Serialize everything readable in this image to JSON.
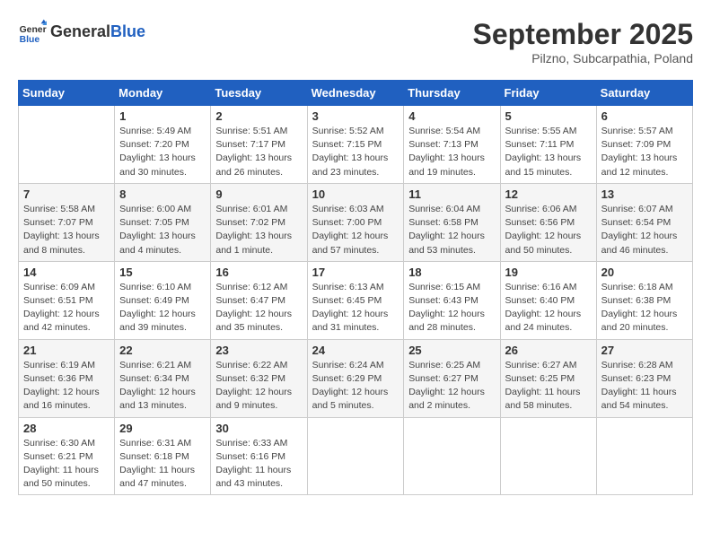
{
  "logo": {
    "text_general": "General",
    "text_blue": "Blue"
  },
  "title": "September 2025",
  "subtitle": "Pilzno, Subcarpathia, Poland",
  "days_of_week": [
    "Sunday",
    "Monday",
    "Tuesday",
    "Wednesday",
    "Thursday",
    "Friday",
    "Saturday"
  ],
  "weeks": [
    [
      {
        "day": "",
        "info": ""
      },
      {
        "day": "1",
        "info": "Sunrise: 5:49 AM\nSunset: 7:20 PM\nDaylight: 13 hours\nand 30 minutes."
      },
      {
        "day": "2",
        "info": "Sunrise: 5:51 AM\nSunset: 7:17 PM\nDaylight: 13 hours\nand 26 minutes."
      },
      {
        "day": "3",
        "info": "Sunrise: 5:52 AM\nSunset: 7:15 PM\nDaylight: 13 hours\nand 23 minutes."
      },
      {
        "day": "4",
        "info": "Sunrise: 5:54 AM\nSunset: 7:13 PM\nDaylight: 13 hours\nand 19 minutes."
      },
      {
        "day": "5",
        "info": "Sunrise: 5:55 AM\nSunset: 7:11 PM\nDaylight: 13 hours\nand 15 minutes."
      },
      {
        "day": "6",
        "info": "Sunrise: 5:57 AM\nSunset: 7:09 PM\nDaylight: 13 hours\nand 12 minutes."
      }
    ],
    [
      {
        "day": "7",
        "info": "Sunrise: 5:58 AM\nSunset: 7:07 PM\nDaylight: 13 hours\nand 8 minutes."
      },
      {
        "day": "8",
        "info": "Sunrise: 6:00 AM\nSunset: 7:05 PM\nDaylight: 13 hours\nand 4 minutes."
      },
      {
        "day": "9",
        "info": "Sunrise: 6:01 AM\nSunset: 7:02 PM\nDaylight: 13 hours\nand 1 minute."
      },
      {
        "day": "10",
        "info": "Sunrise: 6:03 AM\nSunset: 7:00 PM\nDaylight: 12 hours\nand 57 minutes."
      },
      {
        "day": "11",
        "info": "Sunrise: 6:04 AM\nSunset: 6:58 PM\nDaylight: 12 hours\nand 53 minutes."
      },
      {
        "day": "12",
        "info": "Sunrise: 6:06 AM\nSunset: 6:56 PM\nDaylight: 12 hours\nand 50 minutes."
      },
      {
        "day": "13",
        "info": "Sunrise: 6:07 AM\nSunset: 6:54 PM\nDaylight: 12 hours\nand 46 minutes."
      }
    ],
    [
      {
        "day": "14",
        "info": "Sunrise: 6:09 AM\nSunset: 6:51 PM\nDaylight: 12 hours\nand 42 minutes."
      },
      {
        "day": "15",
        "info": "Sunrise: 6:10 AM\nSunset: 6:49 PM\nDaylight: 12 hours\nand 39 minutes."
      },
      {
        "day": "16",
        "info": "Sunrise: 6:12 AM\nSunset: 6:47 PM\nDaylight: 12 hours\nand 35 minutes."
      },
      {
        "day": "17",
        "info": "Sunrise: 6:13 AM\nSunset: 6:45 PM\nDaylight: 12 hours\nand 31 minutes."
      },
      {
        "day": "18",
        "info": "Sunrise: 6:15 AM\nSunset: 6:43 PM\nDaylight: 12 hours\nand 28 minutes."
      },
      {
        "day": "19",
        "info": "Sunrise: 6:16 AM\nSunset: 6:40 PM\nDaylight: 12 hours\nand 24 minutes."
      },
      {
        "day": "20",
        "info": "Sunrise: 6:18 AM\nSunset: 6:38 PM\nDaylight: 12 hours\nand 20 minutes."
      }
    ],
    [
      {
        "day": "21",
        "info": "Sunrise: 6:19 AM\nSunset: 6:36 PM\nDaylight: 12 hours\nand 16 minutes."
      },
      {
        "day": "22",
        "info": "Sunrise: 6:21 AM\nSunset: 6:34 PM\nDaylight: 12 hours\nand 13 minutes."
      },
      {
        "day": "23",
        "info": "Sunrise: 6:22 AM\nSunset: 6:32 PM\nDaylight: 12 hours\nand 9 minutes."
      },
      {
        "day": "24",
        "info": "Sunrise: 6:24 AM\nSunset: 6:29 PM\nDaylight: 12 hours\nand 5 minutes."
      },
      {
        "day": "25",
        "info": "Sunrise: 6:25 AM\nSunset: 6:27 PM\nDaylight: 12 hours\nand 2 minutes."
      },
      {
        "day": "26",
        "info": "Sunrise: 6:27 AM\nSunset: 6:25 PM\nDaylight: 11 hours\nand 58 minutes."
      },
      {
        "day": "27",
        "info": "Sunrise: 6:28 AM\nSunset: 6:23 PM\nDaylight: 11 hours\nand 54 minutes."
      }
    ],
    [
      {
        "day": "28",
        "info": "Sunrise: 6:30 AM\nSunset: 6:21 PM\nDaylight: 11 hours\nand 50 minutes."
      },
      {
        "day": "29",
        "info": "Sunrise: 6:31 AM\nSunset: 6:18 PM\nDaylight: 11 hours\nand 47 minutes."
      },
      {
        "day": "30",
        "info": "Sunrise: 6:33 AM\nSunset: 6:16 PM\nDaylight: 11 hours\nand 43 minutes."
      },
      {
        "day": "",
        "info": ""
      },
      {
        "day": "",
        "info": ""
      },
      {
        "day": "",
        "info": ""
      },
      {
        "day": "",
        "info": ""
      }
    ]
  ]
}
